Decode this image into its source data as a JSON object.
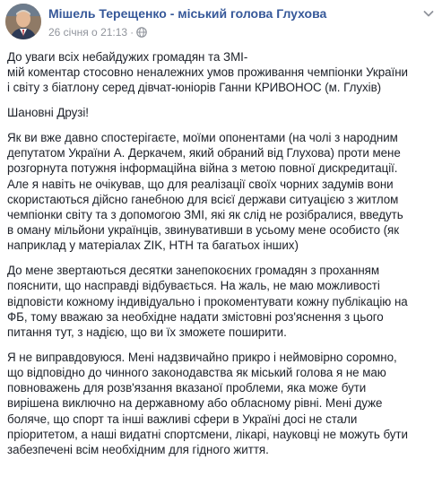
{
  "post": {
    "author": "Мішель Терещенко - міський голова Глухова",
    "timestamp": "26 січня о 21:13",
    "separator": "·",
    "privacy_icon": "globe-icon",
    "menu_icon": "chevron-down-icon",
    "paragraphs": [
      "До уваги всіх небайдужих громадян та ЗМІ-\nмій коментар стосовно неналежних умов проживання чемпіонки України\nі світу з біатлону серед дівчат-юніорів Ганни КРИВОНОС (м. Глухів)",
      "Шановні Друзі!",
      "Як ви вже давно спостерігаєте, моїми опонентами (на чолі з народним\nдепутатом України А. Деркачем, який обраний від Глухова) проти мене\nрозгорнута потужня інформаційна війна з метою повної дискредитації.\nАле я навіть не очікував, що для реалізації своїх чорних задумів вони\nскористаються дійсно ганебною для всієї держави ситуацією з житлом\nчемпіонки світу та з допомогою ЗМІ, які як слід не розібралися, введуть\nв оману мільйони українців, звинувативши в усьому мене особисто (як\nнаприклад у матеріалах ZIK, НТН та багатьох інших)",
      "До мене звертаються десятки занепокоєних громадян з проханням\nпояснити, що насправді відбувається. На жаль, не маю можливості\nвідповісти кожному індивідуально і прокоментувати кожну публікацію на\nФБ, тому вважаю за необхідне надати змістовні роз'яснення з цього\nпитання тут, з надією, що ви їх зможете поширити.",
      "Я не виправдовуюся. Мені надзвичайно прикро і неймовірно соромно,\nщо відповідно до чинного законодавства як міський голова я не маю\nповноважень для розв'язання вказаної проблеми, яка може бути\nвирішена виключно на державному або обласному рівні. Мені дуже\nболяче, що спорт та інші важливі сфери в Україні досі не стали\nпріоритетом, а наші видатні спортсмени, лікарі, науковці не можуть бути\nзабезпечені всім необхідним для гідного життя."
    ]
  },
  "colors": {
    "author_link": "#365899",
    "meta_text": "#90949c",
    "body_text": "#1d2129",
    "background": "#ffffff"
  }
}
